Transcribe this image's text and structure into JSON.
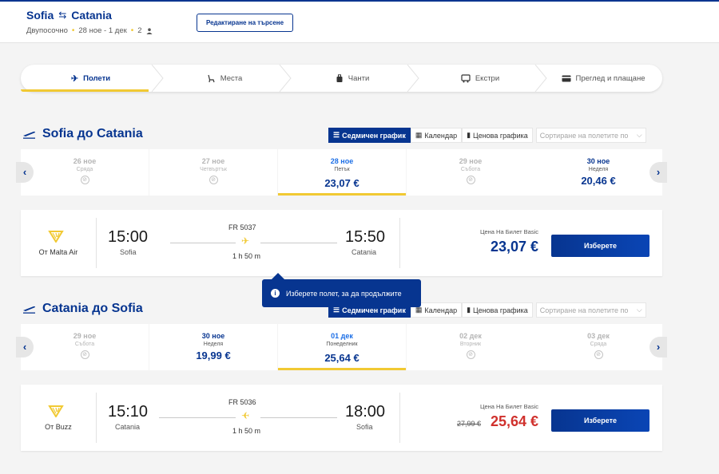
{
  "header": {
    "origin": "Sofia",
    "destination": "Catania",
    "trip_type": "Двупосочно",
    "dates": "28 ное - 1 дек",
    "passengers": "2",
    "edit_label": "Редактиране на търсене"
  },
  "steps": [
    {
      "label": "Полети",
      "icon": "plane-icon"
    },
    {
      "label": "Места",
      "icon": "seat-icon"
    },
    {
      "label": "Чанти",
      "icon": "bag-icon"
    },
    {
      "label": "Екстри",
      "icon": "bus-icon"
    },
    {
      "label": "Преглед и плащане",
      "icon": "card-icon"
    }
  ],
  "views": {
    "weekly": "Седмичен график",
    "calendar": "Календар",
    "price_chart": "Ценова графика",
    "sort_placeholder": "Сортиране на полетите по"
  },
  "outbound": {
    "title": "Sofia до Catania",
    "dates": [
      {
        "date": "26 ное",
        "weekday": "Сряда",
        "price": ""
      },
      {
        "date": "27 ное",
        "weekday": "Четвъртък",
        "price": ""
      },
      {
        "date": "28 ное",
        "weekday": "Петък",
        "price": "23,07 €"
      },
      {
        "date": "29 ное",
        "weekday": "Събота",
        "price": ""
      },
      {
        "date": "30 ное",
        "weekday": "Неделя",
        "price": "20,46 €"
      }
    ],
    "flight": {
      "airline": "От Malta Air",
      "dep_time": "15:00",
      "dep_city": "Sofia",
      "flight_no": "FR 5037",
      "duration": "1 h 50 m",
      "arr_time": "15:50",
      "arr_city": "Catania",
      "price_label": "Цена На Билет Basic",
      "price": "23,07 €",
      "select_label": "Изберете"
    }
  },
  "inbound": {
    "title": "Catania до Sofia",
    "dates": [
      {
        "date": "29 ное",
        "weekday": "Събота",
        "price": ""
      },
      {
        "date": "30 ное",
        "weekday": "Неделя",
        "price": "19,99 €"
      },
      {
        "date": "01 дек",
        "weekday": "Понеделник",
        "price": "25,64 €"
      },
      {
        "date": "02 дек",
        "weekday": "Вторник",
        "price": ""
      },
      {
        "date": "03 дек",
        "weekday": "Сряда",
        "price": ""
      }
    ],
    "flight": {
      "airline": "От Buzz",
      "dep_time": "15:10",
      "dep_city": "Catania",
      "flight_no": "FR 5036",
      "duration": "1 h 50 m",
      "arr_time": "18:00",
      "arr_city": "Sofia",
      "price_label": "Цена На Билет Basic",
      "old_price": "27,99 €",
      "price": "25,64 €",
      "select_label": "Изберете"
    }
  },
  "tooltip": "Изберете полет, за да продължите",
  "colors": {
    "brand": "#073590",
    "accent": "#f1c933",
    "sale": "#d0312d"
  }
}
